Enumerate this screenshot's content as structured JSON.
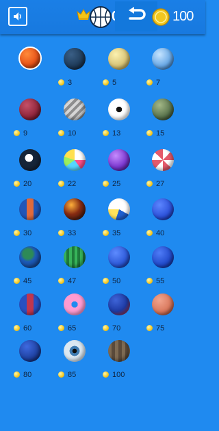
{
  "header": {
    "best_score": "0",
    "coins": "100"
  },
  "balls": [
    {
      "id": "basketball-classic",
      "price": "",
      "selected": true
    },
    {
      "id": "basketball-navy",
      "price": "3"
    },
    {
      "id": "moon",
      "price": "5"
    },
    {
      "id": "blue-speckle",
      "price": "7"
    },
    {
      "id": "crimson-ball",
      "price": "9"
    },
    {
      "id": "silver-swirl",
      "price": "10"
    },
    {
      "id": "soccer-ball",
      "price": "13"
    },
    {
      "id": "camo-ball",
      "price": "15"
    },
    {
      "id": "eight-ball",
      "price": "20"
    },
    {
      "id": "beach-ball",
      "price": "22"
    },
    {
      "id": "purple-planet",
      "price": "25"
    },
    {
      "id": "peppermint",
      "price": "27"
    },
    {
      "id": "orange-blue-ball",
      "price": "30"
    },
    {
      "id": "lava-ball",
      "price": "33"
    },
    {
      "id": "volleyball",
      "price": "35"
    },
    {
      "id": "royal-blue-ball",
      "price": "40"
    },
    {
      "id": "earth-ball",
      "price": "45"
    },
    {
      "id": "watermelon",
      "price": "47"
    },
    {
      "id": "blue-basketball",
      "price": "50"
    },
    {
      "id": "blue-basketball-2",
      "price": "55"
    },
    {
      "id": "red-blue-ball",
      "price": "60"
    },
    {
      "id": "donut",
      "price": "65"
    },
    {
      "id": "blue-red-ball",
      "price": "70"
    },
    {
      "id": "salmon-ball",
      "price": "75"
    },
    {
      "id": "dark-blue-ball",
      "price": "80"
    },
    {
      "id": "eyeball",
      "price": "85"
    },
    {
      "id": "pumpkin",
      "price": "100"
    }
  ],
  "colors": {
    "background": "#1f8af0",
    "coin": "#f3c720"
  }
}
